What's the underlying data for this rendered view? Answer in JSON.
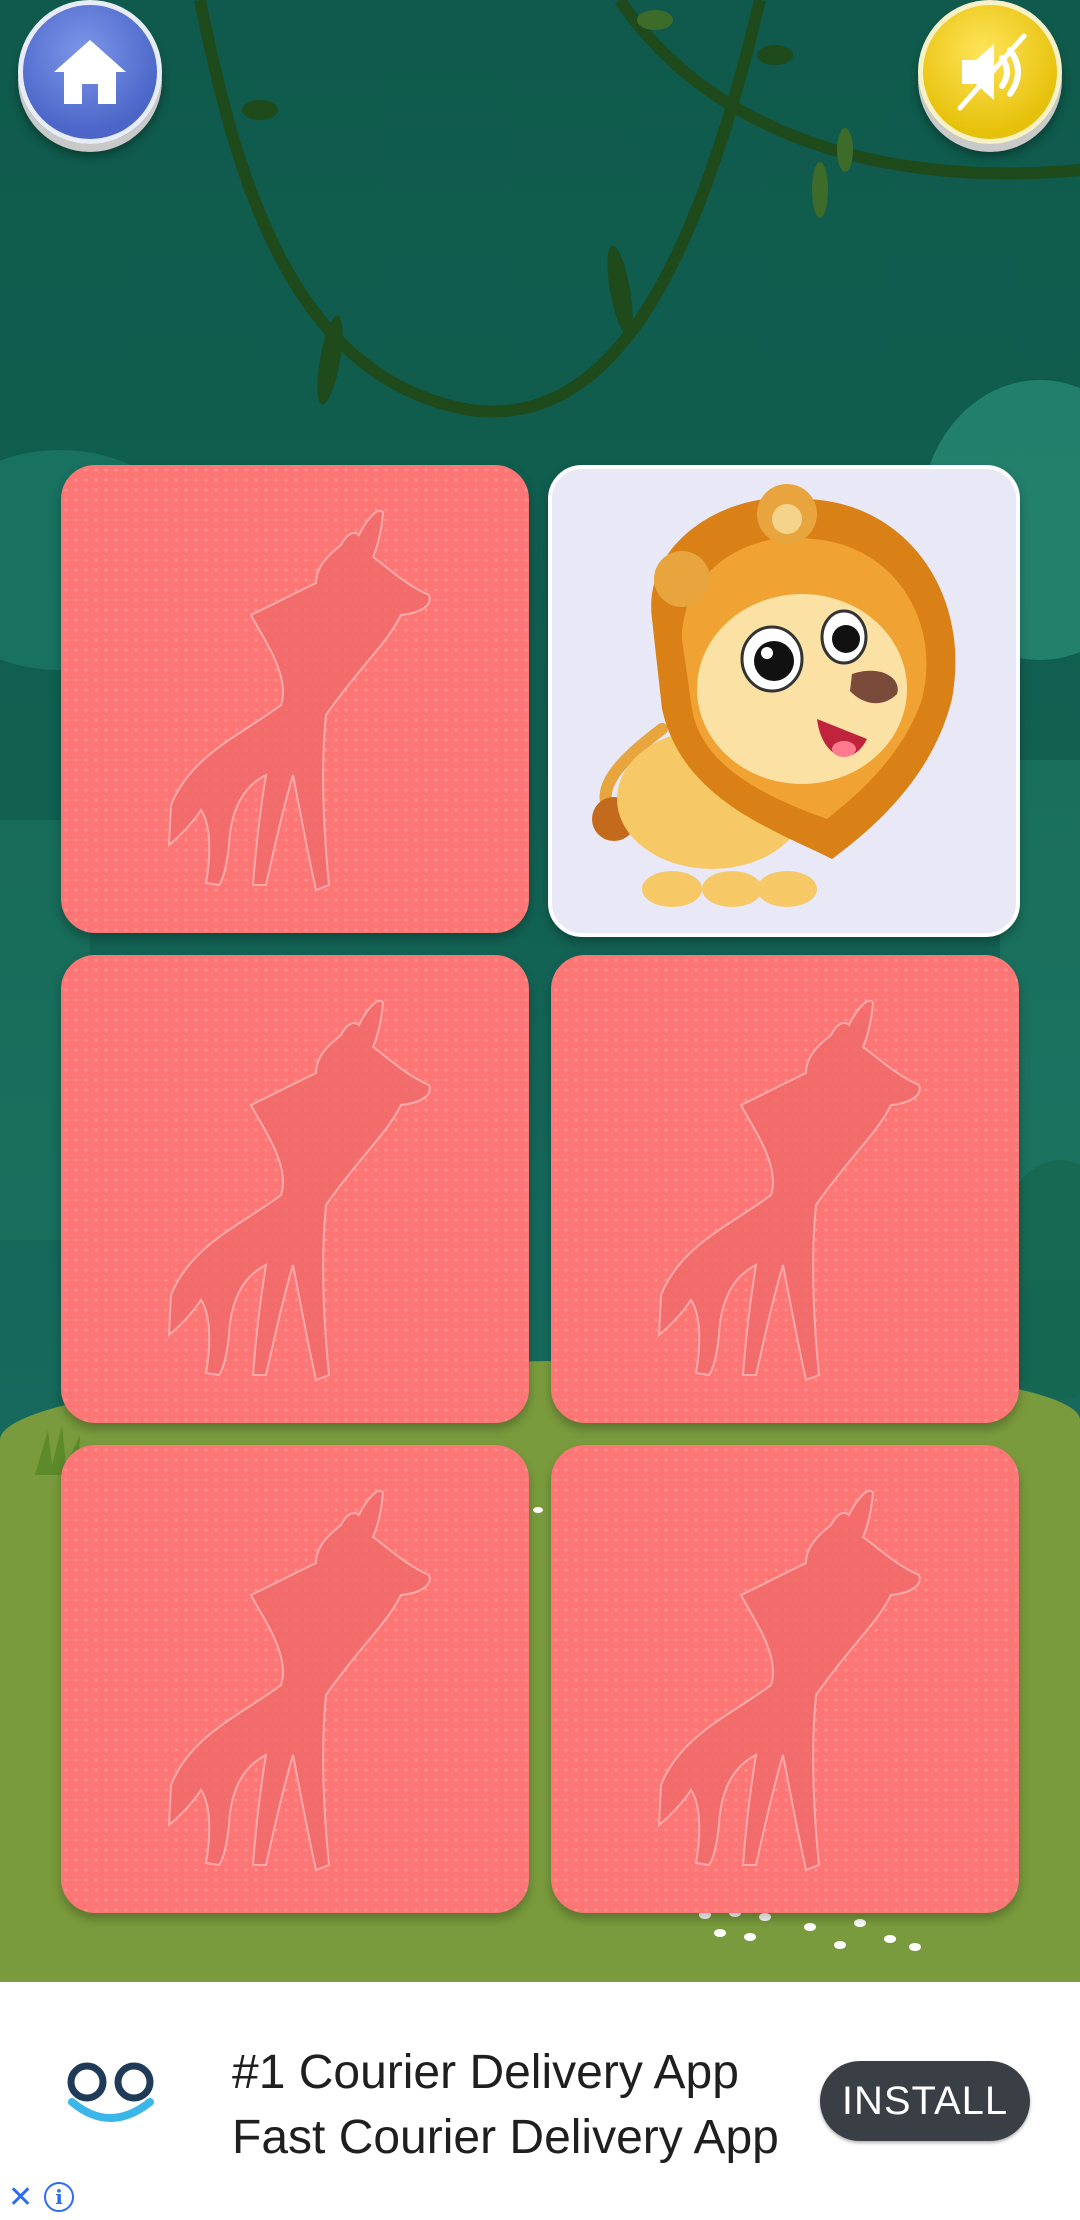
{
  "top_bar": {
    "home_icon": "home-icon",
    "sound_icon": "sound-muted-icon",
    "colors": {
      "home": "#5a74d6",
      "sound": "#f4d21a"
    }
  },
  "board": {
    "card_back_color": "#fd7676",
    "card_back_icon": "giraffe-silhouette-icon",
    "cards": [
      {
        "state": "face-down",
        "icon": "giraffe-silhouette-icon"
      },
      {
        "state": "face-up",
        "icon": "lion-icon"
      },
      {
        "state": "face-down",
        "icon": "giraffe-silhouette-icon"
      },
      {
        "state": "face-down",
        "icon": "giraffe-silhouette-icon"
      },
      {
        "state": "face-down",
        "icon": "giraffe-silhouette-icon"
      },
      {
        "state": "face-down",
        "icon": "giraffe-silhouette-icon"
      }
    ]
  },
  "ad": {
    "logo_icon": "courier-app-logo-icon",
    "line1": "#1 Courier Delivery App",
    "line2": "Fast Courier Delivery App",
    "install_label": "INSTALL",
    "close_glyph": "✕",
    "info_glyph": "i"
  }
}
